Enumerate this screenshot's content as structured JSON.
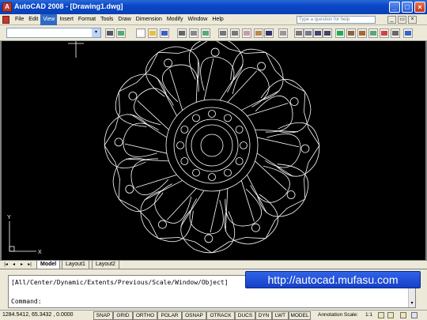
{
  "app": {
    "title": "AutoCAD 2008 - [Drawing1.dwg]",
    "logo_letter": "A",
    "window_buttons": {
      "minimize": "_",
      "maximize": "□",
      "close": "×"
    }
  },
  "menubar": {
    "items": [
      "File",
      "Edit",
      "View",
      "Insert",
      "Format",
      "Tools",
      "Draw",
      "Dimension",
      "Modify",
      "Window",
      "Help"
    ],
    "active": "View",
    "help_placeholder": "Type a question for help",
    "doc_buttons": {
      "minimize": "_",
      "restore": "▭",
      "close": "×"
    }
  },
  "toolbar": {
    "workspace_value": "",
    "dropdown_glyph": "▾",
    "tools": [
      "gear-icon",
      "palette-icon",
      "new-icon",
      "open-icon",
      "save-icon",
      "print-icon",
      "preview-icon",
      "publish-icon",
      "cut-icon",
      "copy-icon",
      "paste-icon",
      "match-icon",
      "undo-icon",
      "redo-icon",
      "pan-icon",
      "zoom-icon",
      "zoom-window-icon",
      "zoom-previous-icon",
      "properties-icon",
      "design-center-icon",
      "tool-palette-icon",
      "sheet-set-icon",
      "markup-icon",
      "calculator-icon",
      "help-icon"
    ]
  },
  "layout_tabs": {
    "nav": [
      "|◂",
      "◂",
      "▸",
      "▸|"
    ],
    "tabs": [
      "Model",
      "Layout1",
      "Layout2"
    ],
    "active": "Model"
  },
  "ucs": {
    "x_label": "X",
    "y_label": "Y"
  },
  "command": {
    "history": "[All/Center/Dynamic/Extents/Previous/Scale/Window/Object]",
    "prompt": "Command:",
    "scroll_up": "▴",
    "scroll_down": "▾"
  },
  "watermark": "http://autocad.mufasu.com",
  "statusbar": {
    "coords": "1284.5412, 65.3432 , 0.0000",
    "toggles": [
      "SNAP",
      "GRID",
      "ORTHO",
      "POLAR",
      "OSNAP",
      "OTRACK",
      "DUCS",
      "DYN",
      "LWT",
      "MODEL"
    ],
    "annotation_scale_label": "Annotation Scale:",
    "annotation_scale_value": "1:1"
  },
  "colors": {
    "title_bar": "#0a47c6",
    "canvas": "#000000",
    "drawing_lines": "#ffffff",
    "watermark_bg": "#1e4fd8",
    "menu_highlight": "#316ac5"
  }
}
